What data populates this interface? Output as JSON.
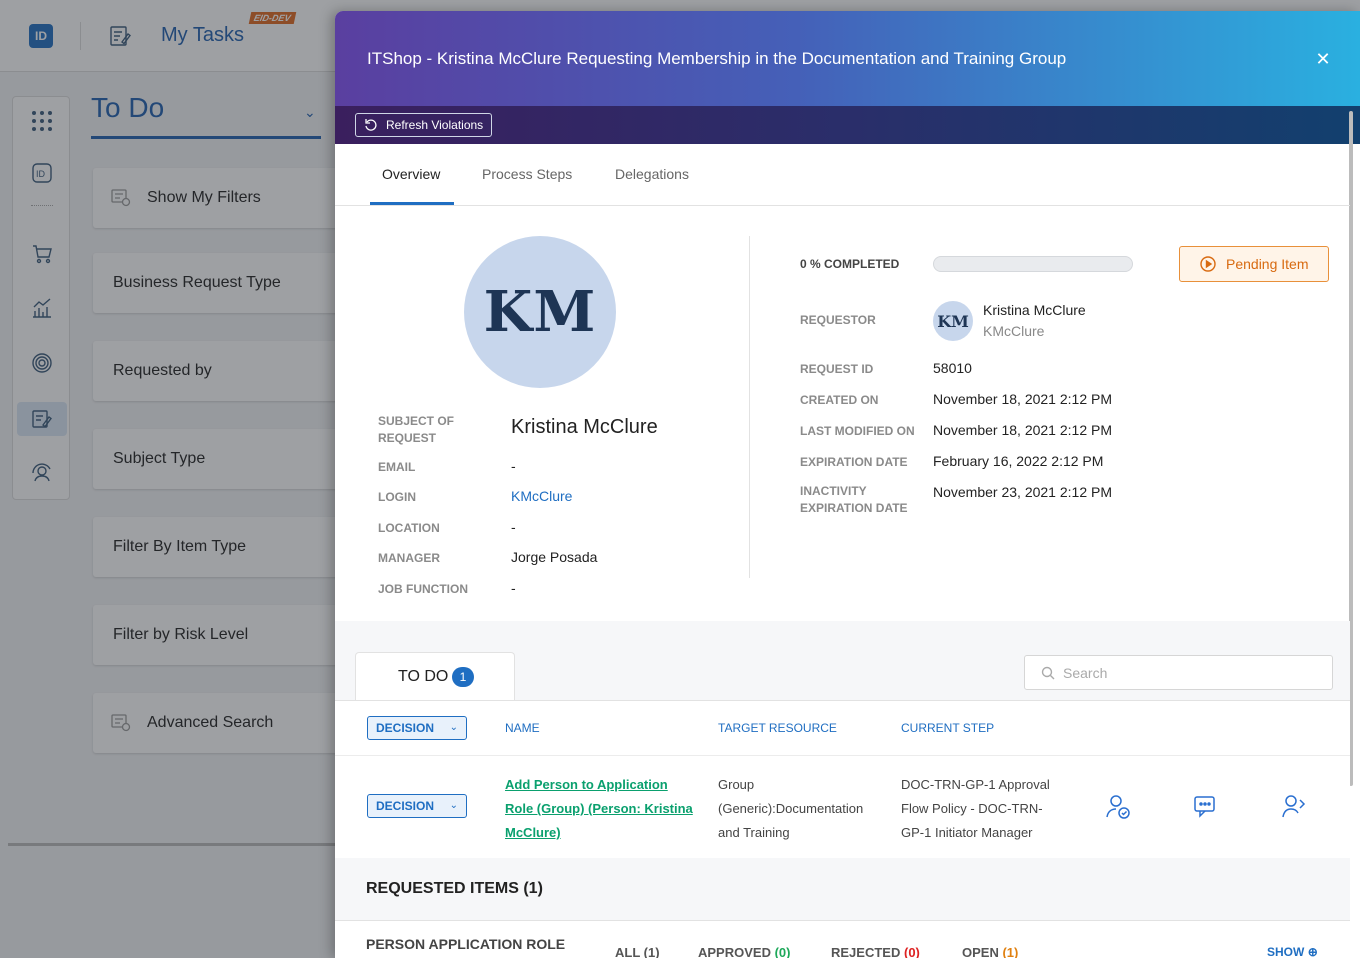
{
  "app": {
    "logo": "ID",
    "title": "My Tasks",
    "env_badge": "EID-DEV"
  },
  "background": {
    "header": "To Do",
    "filters": [
      {
        "label": "Show My Filters",
        "icon": "filter-icon"
      },
      {
        "label": "Business Request Type"
      },
      {
        "label": "Requested by"
      },
      {
        "label": "Subject Type"
      },
      {
        "label": "Filter By Item Type"
      },
      {
        "label": "Filter by Risk Level"
      },
      {
        "label": "Advanced Search",
        "icon": "filter-icon"
      }
    ],
    "rail_icons": [
      "apps-grid-icon",
      "id-card-icon",
      "cart-icon",
      "analytics-icon",
      "fingerprint-icon",
      "tasks-icon",
      "user-review-icon"
    ]
  },
  "modal": {
    "title": "ITShop - Kristina McClure Requesting Membership in the Documentation and Training Group",
    "refresh_label": "Refresh Violations",
    "tabs": [
      "Overview",
      "Process Steps",
      "Delegations"
    ],
    "active_tab": "Overview",
    "subject": {
      "initials": "KM",
      "name": "Kristina McClure",
      "labels": {
        "subject": "SUBJECT OF REQUEST",
        "email": "EMAIL",
        "login": "LOGIN",
        "location": "LOCATION",
        "manager": "MANAGER",
        "job_function": "JOB FUNCTION"
      },
      "email": "-",
      "login": "KMcClure",
      "location": "-",
      "manager": "Jorge Posada",
      "job_function": "-"
    },
    "details": {
      "completed_label": "0 % COMPLETED",
      "progress": 0,
      "pending_label": "Pending Item",
      "labels": {
        "requestor": "REQUESTOR",
        "request_id": "REQUEST ID",
        "created_on": "CREATED ON",
        "last_modified_on": "LAST MODIFIED ON",
        "expiration_date": "EXPIRATION DATE",
        "inactivity_expiration_date": "INACTIVITY EXPIRATION DATE"
      },
      "requestor_initials": "KM",
      "requestor_name": "Kristina McClure",
      "requestor_login": "KMcClure",
      "request_id": "58010",
      "created_on": "November 18, 2021 2:12 PM",
      "last_modified_on": "November 18, 2021 2:12 PM",
      "expiration_date": "February 16, 2022 2:12 PM",
      "inactivity_expiration_date": "November 23, 2021 2:12 PM"
    },
    "todo": {
      "tab_label": "TO DO",
      "count": "1",
      "search_placeholder": "Search",
      "columns": {
        "decision": "DECISION",
        "name": "NAME",
        "target_resource": "TARGET RESOURCE",
        "current_step": "CURRENT STEP"
      },
      "rows": [
        {
          "decision": "DECISION",
          "name": "Add Person to Application Role (Group) (Person: Kristina McClure)",
          "target_resource": "Group (Generic):Documentation and Training",
          "current_step": "DOC-TRN-GP-1 Approval Flow Policy - DOC-TRN-GP-1 Initiator Manager",
          "actions": [
            "assign-reviewer-icon",
            "comments-icon",
            "delegate-icon"
          ]
        }
      ]
    },
    "requested_items": {
      "title": "REQUESTED ITEMS (1)",
      "type": "PERSON APPLICATION ROLE",
      "all_label": "ALL",
      "all_count": "(1)",
      "approved_label": "APPROVED",
      "approved_count": "(0)",
      "rejected_label": "REJECTED",
      "rejected_count": "(0)",
      "open_label": "OPEN",
      "open_count": "(1)",
      "show_label": "SHOW"
    }
  }
}
